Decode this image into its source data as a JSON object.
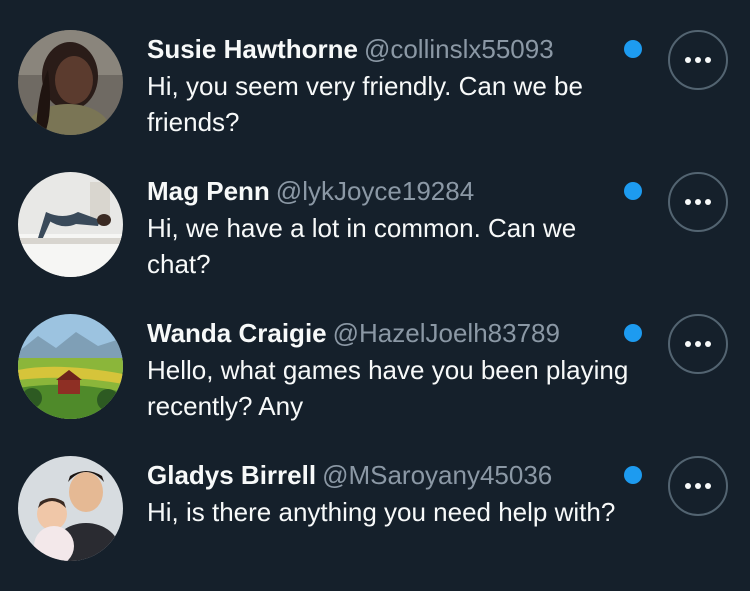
{
  "colors": {
    "background": "#15202b",
    "primary_text": "#f7f9f9",
    "secondary_text": "#8b98a5",
    "accent_dot": "#1d9bf0",
    "button_border": "#536471"
  },
  "messages": [
    {
      "name": "Susie Hawthorne",
      "handle": "@collinslx55093",
      "text": "Hi, you seem very friendly. Can we be friends?",
      "avatar_icon": "woman-portrait-avatar",
      "unread": true
    },
    {
      "name": "Mag Penn",
      "handle": "@lykJoyce19284",
      "text": "Hi, we have a lot in common. Can we chat?",
      "avatar_icon": "woman-on-bed-avatar",
      "unread": true
    },
    {
      "name": "Wanda Craigie",
      "handle": "@HazelJoelh83789",
      "text": "Hello, what games have you been playing recently? Any",
      "avatar_icon": "countryside-landscape-avatar",
      "unread": true
    },
    {
      "name": "Gladys Birrell",
      "handle": "@MSaroyany45036",
      "text": "Hi, is there anything you need help with?",
      "avatar_icon": "man-with-baby-avatar",
      "unread": true
    }
  ]
}
